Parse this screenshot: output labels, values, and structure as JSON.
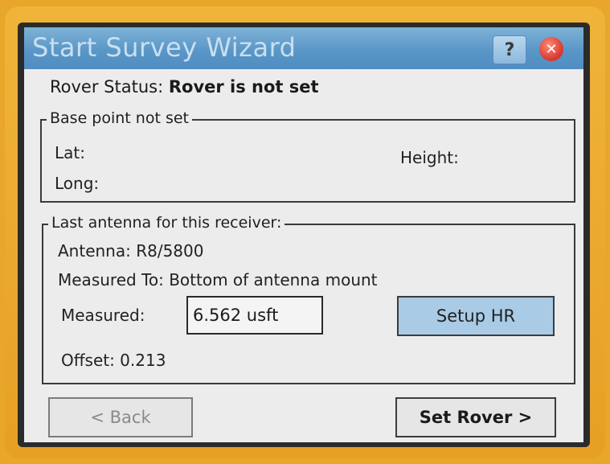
{
  "window": {
    "title": "Start Survey Wizard",
    "help_label": "?",
    "close_label": "✕"
  },
  "rover": {
    "status_label": "Rover Status:",
    "status_value": "Rover is not set"
  },
  "base_point": {
    "legend": "Base point not set",
    "lat_label": "Lat:",
    "long_label": "Long:",
    "height_label": "Height:"
  },
  "antenna": {
    "legend": "Last antenna for this receiver:",
    "antenna_text": "Antenna: R8/5800",
    "measured_to_text": "Measured To: Bottom of antenna mount",
    "measured_label": "Measured:",
    "measured_value": "6.562 usft",
    "setup_hr_label": "Setup HR",
    "offset_text": "Offset: 0.213"
  },
  "footer": {
    "back_label": "< Back",
    "set_rover_label": "Set Rover >"
  },
  "colors": {
    "bezel": "#e8a62a",
    "titlebar": "#5a97c8",
    "button_accent": "#a9cbe6",
    "close_icon": "#d8352a"
  }
}
